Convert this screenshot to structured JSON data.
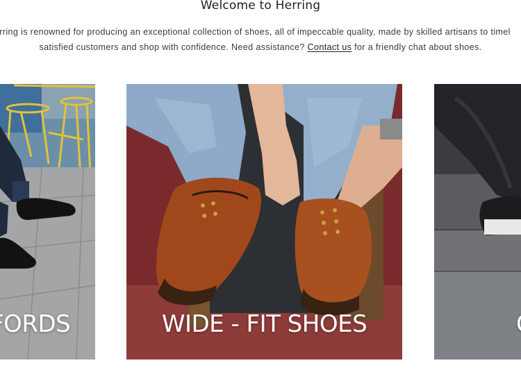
{
  "intro": {
    "title": "Welcome to Herring",
    "line1": "rring is renowned for producing an exceptional collection of shoes, all of impeccable quality, made by skilled artisans to timel",
    "line2_before": "satisfied customers and shop with confidence. Need assistance? ",
    "contact_link": "Contact us",
    "line2_after": " for a friendly chat about shoes."
  },
  "categories": [
    {
      "label": "FORDS"
    },
    {
      "label": "WIDE - FIT SHOES"
    },
    {
      "label": "C"
    }
  ]
}
